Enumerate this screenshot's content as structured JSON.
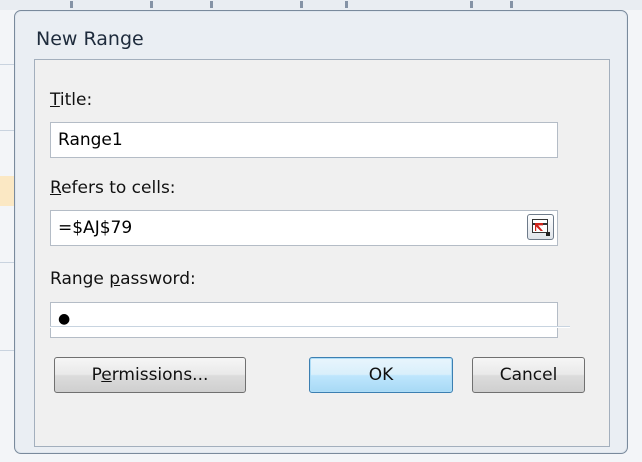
{
  "dialog": {
    "title": "New Range"
  },
  "fields": {
    "title": {
      "label_pre": "",
      "label_key": "T",
      "label_post": "itle:",
      "value": "Range1"
    },
    "refers_to": {
      "label_pre": "",
      "label_key": "R",
      "label_post": "efers to cells:",
      "value": "=$AJ$79"
    },
    "password": {
      "label_pre": "Range ",
      "label_key": "p",
      "label_post": "assword:",
      "value": "●"
    }
  },
  "buttons": {
    "permissions": {
      "pre": "P",
      "key": "e",
      "post": "rmissions..."
    },
    "ok": {
      "label": "OK"
    },
    "cancel": {
      "label": "Cancel"
    }
  },
  "icons": {
    "refedit": "collapse-dialog-icon"
  }
}
